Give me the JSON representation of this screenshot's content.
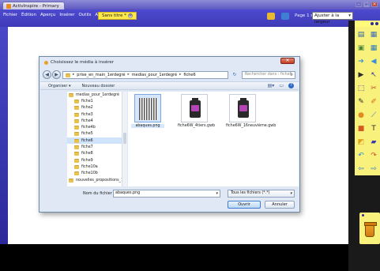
{
  "app": {
    "tab_title": "ActivInspire - Primary",
    "window_controls": [
      "–",
      "□",
      "✕"
    ]
  },
  "menubar": {
    "menus": [
      "Fichier",
      "Édition",
      "Aperçu",
      "Insérer",
      "Outils",
      "Aide"
    ],
    "doc_tab": "Sans titre *",
    "doc_tab_close": "⊗",
    "page_info": "Page 1 sur 1",
    "zoom": "Ajuster à la largeur"
  },
  "dialog": {
    "title": "Choisissez le média à insérer",
    "close": "✕",
    "address": [
      "prise_en_main_1erdegré",
      "medias_pour_1erdegré",
      "fiche6"
    ],
    "search_placeholder": "Rechercher dans : fiche6",
    "organize": "Organiser ▾",
    "new_folder": "Nouveau dossier",
    "tree": [
      {
        "label": "medias_pour_1erdegré",
        "level": "root",
        "selected": false
      },
      {
        "label": "fiche1",
        "level": "child",
        "selected": false
      },
      {
        "label": "fiche2",
        "level": "child",
        "selected": false
      },
      {
        "label": "fiche3",
        "level": "child",
        "selected": false
      },
      {
        "label": "fiche4",
        "level": "child",
        "selected": false
      },
      {
        "label": "fiche4b",
        "level": "child",
        "selected": false
      },
      {
        "label": "fiche5",
        "level": "child",
        "selected": false
      },
      {
        "label": "fiche6",
        "level": "child",
        "selected": true
      },
      {
        "label": "fiche7",
        "level": "child",
        "selected": false
      },
      {
        "label": "fiche8",
        "level": "child",
        "selected": false
      },
      {
        "label": "fiche9",
        "level": "child",
        "selected": false
      },
      {
        "label": "fiche10a",
        "level": "child",
        "selected": false
      },
      {
        "label": "fiche10b",
        "level": "child",
        "selected": false
      },
      {
        "label": "nouvelles_propositions_1er_",
        "level": "root",
        "selected": false
      }
    ],
    "files": [
      {
        "name": "abaques.png",
        "kind": "barcode",
        "selected": true
      },
      {
        "name": "fiche6W_4tiers.gwb",
        "kind": "gwb",
        "selected": false
      },
      {
        "name": "fiche6W_16neuvième.gwb",
        "kind": "gwb",
        "selected": false
      }
    ],
    "filename_label": "Nom du fichier :",
    "filename_value": "abaques.png",
    "filetype": "Tous les fichiers (*.*)",
    "open_button": "Ouvrir",
    "cancel_button": "Annuler"
  },
  "colors": {
    "titlebar": "#5c58c0",
    "menubar": "#4e4ad0",
    "doc_tab": "#ffe94a",
    "toolbox": "#f8f17b"
  },
  "toolbox": {
    "tools": [
      {
        "icon": "pages-icon",
        "color": "#2a5fa8"
      },
      {
        "icon": "browser-icon",
        "color": "#3e6bb5"
      },
      {
        "icon": "image-icon",
        "color": "#4a8a3a"
      },
      {
        "icon": "grid-icon",
        "color": "#2c78b8"
      },
      {
        "icon": "next-page-icon",
        "color": "#3b8ed8"
      },
      {
        "icon": "previous-page-icon",
        "color": "#3b8ed8"
      },
      {
        "icon": "play-icon",
        "color": "#2c2c2c"
      },
      {
        "icon": "pointer-icon",
        "color": "#2a2aa0"
      },
      {
        "icon": "select-icon",
        "color": "#2a2aa0"
      },
      {
        "icon": "tools-icon",
        "color": "#b84a2a"
      },
      {
        "icon": "pen-icon",
        "color": "#2a2a2a"
      },
      {
        "icon": "highlighter-icon",
        "color": "#d06a10"
      },
      {
        "icon": "magic-ink-icon",
        "color": "#e08a20"
      },
      {
        "icon": "connector-icon",
        "color": "#3a6ac8"
      },
      {
        "icon": "shape-icon",
        "color": "#d45a20"
      },
      {
        "icon": "text-icon",
        "color": "#2a2a2a"
      },
      {
        "icon": "fill-icon",
        "color": "#e0a020"
      },
      {
        "icon": "eraser-icon",
        "color": "#3a3ab0"
      },
      {
        "icon": "undo-icon",
        "color": "#2a8ad8"
      },
      {
        "icon": "redo-icon",
        "color": "#d04a2a"
      },
      {
        "icon": "left-arrow-icon",
        "color": "#3a7ad0"
      },
      {
        "icon": "right-arrow-icon",
        "color": "#3a7ad0"
      }
    ],
    "trash": "trash-icon"
  }
}
